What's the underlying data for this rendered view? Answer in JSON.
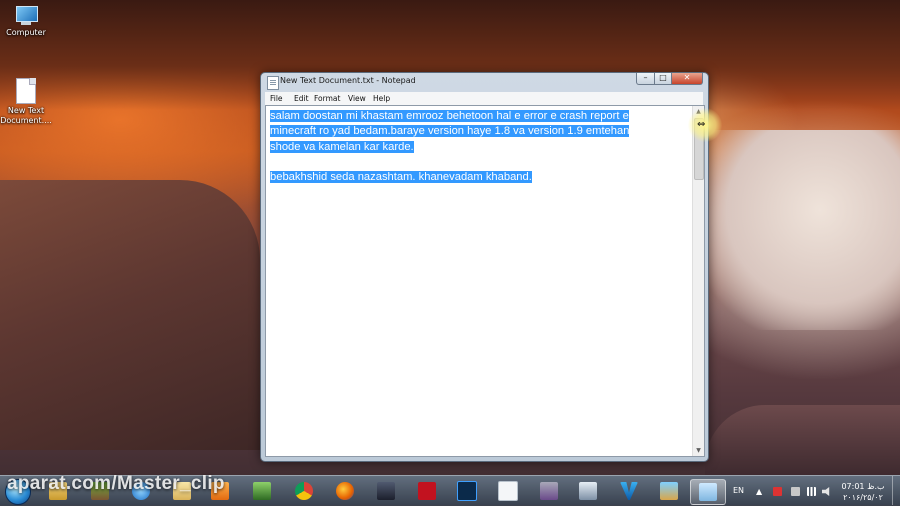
{
  "desktop": {
    "icons": [
      {
        "label": "Computer"
      },
      {
        "label": "New Text\nDocument...."
      }
    ]
  },
  "window": {
    "title": "New Text Document.txt - Notepad",
    "controls": {
      "minimize": "–",
      "maximize": "□",
      "close": "✕"
    },
    "menu": [
      "File",
      "Edit",
      "Format",
      "View",
      "Help"
    ],
    "document_lines": [
      "salam doostan mi khastam emrooz behetoon hal e error e crash report e",
      "minecraft ro yad bedam.baraye version haye 1.8 va version 1.9 emtehan",
      "shode va kamelan kar karde.",
      "",
      "bebakhshid seda nazashtam. khanevadam khaband."
    ],
    "selection_color": "#3399ff"
  },
  "taskbar": {
    "watermark": "aparat.com/Master_clip",
    "pinned_icons": [
      "windows-explorer-icon",
      "minecraft-icon",
      "minecraft-block-icon",
      "internet-explorer-icon",
      "folder-icon",
      "media-player-icon",
      "minecraft-launcher-icon",
      "chrome-icon",
      "firefox-icon",
      "game-icon",
      "flash-icon",
      "photoshop-icon",
      "blank-document-icon",
      "archive-icon",
      "screen-recorder-icon",
      "v-app-icon",
      "cleaner-icon",
      "notepad-icon"
    ],
    "tray": {
      "language": "EN",
      "time": "07:01 ب.ظ",
      "date": "۲۰۱۶/۲۵/۰۲"
    }
  }
}
